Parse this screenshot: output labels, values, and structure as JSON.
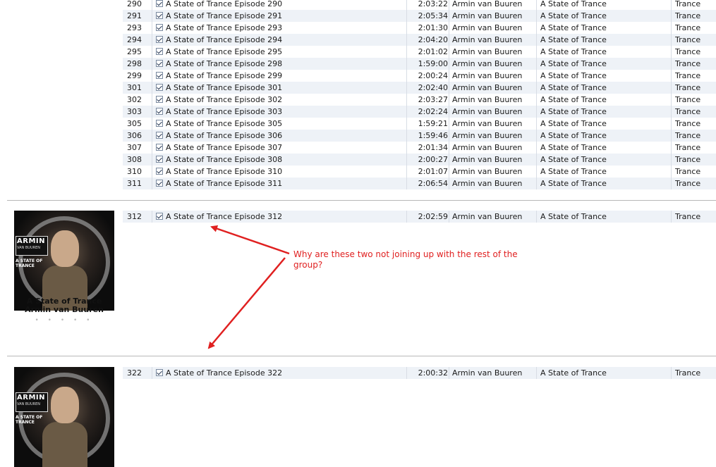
{
  "columns": {
    "count": "",
    "name": "",
    "time": "",
    "artist": "",
    "album": "",
    "genre": ""
  },
  "group1_tracks": [
    {
      "num": "290",
      "name": "A State of Trance Episode 290",
      "time": "2:03:22",
      "artist": "Armin van Buuren",
      "album": "A State of Trance",
      "genre": "Trance"
    },
    {
      "num": "291",
      "name": "A State of Trance Episode 291",
      "time": "2:05:34",
      "artist": "Armin van Buuren",
      "album": "A State of Trance",
      "genre": "Trance"
    },
    {
      "num": "293",
      "name": "A State of Trance Episode 293",
      "time": "2:01:30",
      "artist": "Armin van Buuren",
      "album": "A State of Trance",
      "genre": "Trance"
    },
    {
      "num": "294",
      "name": "A State of Trance Episode 294",
      "time": "2:04:20",
      "artist": "Armin van Buuren",
      "album": "A State of Trance",
      "genre": "Trance"
    },
    {
      "num": "295",
      "name": "A State of Trance Episode 295",
      "time": "2:01:02",
      "artist": "Armin van Buuren",
      "album": "A State of Trance",
      "genre": "Trance"
    },
    {
      "num": "298",
      "name": "A State of Trance Episode 298",
      "time": "1:59:00",
      "artist": "Armin van Buuren",
      "album": "A State of Trance",
      "genre": "Trance"
    },
    {
      "num": "299",
      "name": "A State of Trance Episode 299",
      "time": "2:00:24",
      "artist": "Armin van Buuren",
      "album": "A State of Trance",
      "genre": "Trance"
    },
    {
      "num": "301",
      "name": "A State of Trance Episode 301",
      "time": "2:02:40",
      "artist": "Armin van Buuren",
      "album": "A State of Trance",
      "genre": "Trance"
    },
    {
      "num": "302",
      "name": "A State of Trance Episode 302",
      "time": "2:03:27",
      "artist": "Armin van Buuren",
      "album": "A State of Trance",
      "genre": "Trance"
    },
    {
      "num": "303",
      "name": "A State of Trance Episode 303",
      "time": "2:02:24",
      "artist": "Armin van Buuren",
      "album": "A State of Trance",
      "genre": "Trance"
    },
    {
      "num": "305",
      "name": "A State of Trance Episode 305",
      "time": "1:59:21",
      "artist": "Armin van Buuren",
      "album": "A State of Trance",
      "genre": "Trance"
    },
    {
      "num": "306",
      "name": "A State of Trance Episode 306",
      "time": "1:59:46",
      "artist": "Armin van Buuren",
      "album": "A State of Trance",
      "genre": "Trance"
    },
    {
      "num": "307",
      "name": "A State of Trance Episode 307",
      "time": "2:01:34",
      "artist": "Armin van Buuren",
      "album": "A State of Trance",
      "genre": "Trance"
    },
    {
      "num": "308",
      "name": "A State of Trance Episode 308",
      "time": "2:00:27",
      "artist": "Armin van Buuren",
      "album": "A State of Trance",
      "genre": "Trance"
    },
    {
      "num": "310",
      "name": "A State of Trance Episode 310",
      "time": "2:01:07",
      "artist": "Armin van Buuren",
      "album": "A State of Trance",
      "genre": "Trance"
    },
    {
      "num": "311",
      "name": "A State of Trance Episode 311",
      "time": "2:06:54",
      "artist": "Armin van Buuren",
      "album": "A State of Trance",
      "genre": "Trance"
    }
  ],
  "group2": {
    "track": {
      "num": "312",
      "name": "A State of Trance Episode 312",
      "time": "2:02:59",
      "artist": "Armin van Buuren",
      "album": "A State of Trance",
      "genre": "Trance"
    },
    "art_album": "A State of Trance",
    "art_artist": "Armin van Buuren",
    "rating_dots": "• • • • •"
  },
  "group3": {
    "track": {
      "num": "322",
      "name": "A State of Trance Episode 322",
      "time": "2:00:32",
      "artist": "Armin van Buuren",
      "album": "A State of Trance",
      "genre": "Trance"
    }
  },
  "artwork_text": {
    "line1": "ARMIN",
    "line2": "VAN BUUREN",
    "line3": "A STATE OF",
    "line4": "TRANCE"
  },
  "annotation": "Why are these two not joining up with the rest of the group?",
  "colors": {
    "annotation": "#e02020",
    "row_alt": "#eef2f7"
  }
}
